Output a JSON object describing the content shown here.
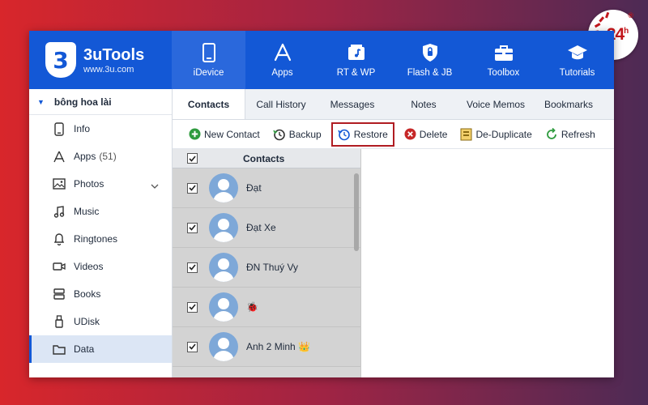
{
  "watermark": {
    "number": "24",
    "superscript": "h",
    "registered": "®"
  },
  "brand": {
    "logo_glyph": "3",
    "name": "3uTools",
    "url": "www.3u.com",
    "color": "#1358d6"
  },
  "nav": [
    {
      "label": "iDevice",
      "icon": "phone-icon"
    },
    {
      "label": "Apps",
      "icon": "app-store-icon"
    },
    {
      "label": "RT & WP",
      "icon": "ringtone-wallpaper-icon"
    },
    {
      "label": "Flash & JB",
      "icon": "shield-icon"
    },
    {
      "label": "Toolbox",
      "icon": "toolbox-icon"
    },
    {
      "label": "Tutorials",
      "icon": "graduation-cap-icon"
    }
  ],
  "sidebar": {
    "device_name": "bông hoa lài",
    "items": [
      {
        "label": "Info",
        "icon": "phone-outline-icon",
        "count": ""
      },
      {
        "label": "Apps",
        "icon": "app-store-icon",
        "count": "(51)"
      },
      {
        "label": "Photos",
        "icon": "photo-icon",
        "count": ""
      },
      {
        "label": "Music",
        "icon": "music-note-icon",
        "count": ""
      },
      {
        "label": "Ringtones",
        "icon": "bell-icon",
        "count": ""
      },
      {
        "label": "Videos",
        "icon": "video-icon",
        "count": ""
      },
      {
        "label": "Books",
        "icon": "books-icon",
        "count": ""
      },
      {
        "label": "UDisk",
        "icon": "usb-icon",
        "count": ""
      },
      {
        "label": "Data",
        "icon": "folder-icon",
        "count": ""
      }
    ]
  },
  "subtabs": [
    "Contacts",
    "Call History",
    "Messages",
    "Notes",
    "Voice Memos",
    "Bookmarks"
  ],
  "toolbar": {
    "new_contact": "New Contact",
    "backup": "Backup",
    "restore": "Restore",
    "delete": "Delete",
    "dedupe": "De-Duplicate",
    "refresh": "Refresh"
  },
  "contacts": {
    "header": "Contacts",
    "rows": [
      "Đạt",
      "Đạt Xe",
      "ĐN Thuý Vy",
      "🐞",
      "Anh 2 Minh 👑"
    ]
  }
}
